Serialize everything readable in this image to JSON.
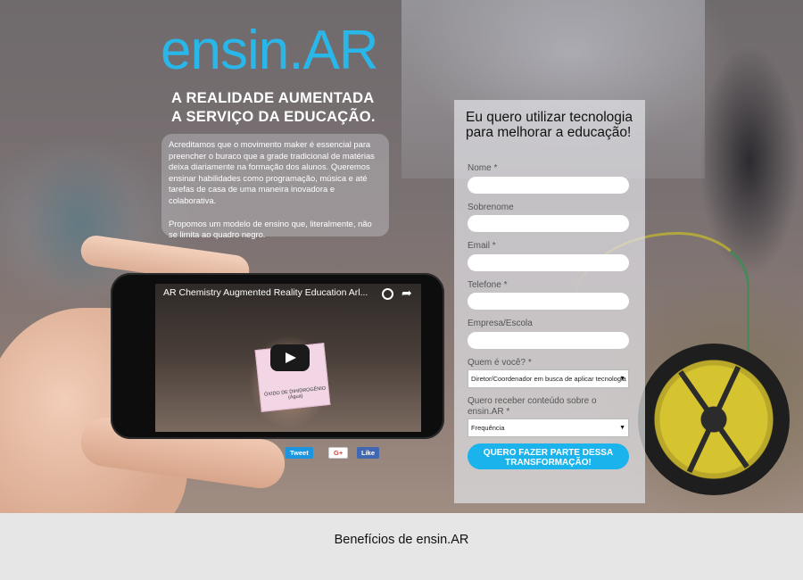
{
  "logo": "ensin.AR",
  "tagline": [
    "A REALIDADE AUMENTADA",
    "A SERVIÇO DA EDUCAÇÃO."
  ],
  "intro": {
    "p1": "Acreditamos que o movimento maker é essencial para preencher o buraco que a grade tradicional de matérias deixa diariamente na formação dos alunos. Queremos ensinar habilidades como programação, música e até tarefas de casa de uma maneira inovadora e colaborativa.",
    "p2": "Propomos um modelo de ensino que, literalmente, não se limita ao quadro negro."
  },
  "video": {
    "title": "AR Chemistry Augmented Reality Education Arl...",
    "card_text": "ÓXIDO DE DIHIDROGÊNIO (Água)"
  },
  "social": {
    "tweet": "Tweet",
    "gplus": "G+",
    "like": "Like"
  },
  "form": {
    "title": "Eu quero utilizar tecnologia para melhorar a educação!",
    "labels": {
      "nome": "Nome  *",
      "sobrenome": "Sobrenome",
      "email": "Email *",
      "telefone": "Telefone *",
      "empresa": "Empresa/Escola",
      "quem": "Quem é você? *",
      "conteudo": "Quero receber conteúdo sobre o ensin.AR *"
    },
    "quem_value": "Diretor/Coordenador em busca de aplicar tecnologia",
    "conteudo_value": "Frequência",
    "submit": "QUERO FAZER PARTE DESSA TRANSFORMAÇÃO!"
  },
  "benefits_title": "Benefícios de ensin.AR",
  "colors": {
    "brand": "#29b6e8",
    "cta": "#1ab3ec"
  },
  "icons": [
    "play-icon",
    "clock-icon",
    "share-icon",
    "select-arrow-icon"
  ]
}
